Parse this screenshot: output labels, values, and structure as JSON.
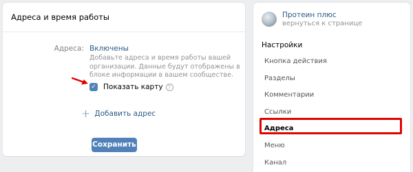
{
  "main": {
    "title": "Адреса и время работы",
    "field_label": "Адреса:",
    "field_value": "Включены",
    "hint": "Добавьте адреса и время работы вашей организации. Данные будут отображены в блоке информации в вашем сообществе.",
    "checkbox_label": "Показать карту",
    "checkbox_checked": true,
    "help_icon": "?",
    "add_address_label": "Добавить адрес",
    "save_label": "Сохранить"
  },
  "side": {
    "community_name": "Протеин плюс",
    "community_back": "вернуться к странице",
    "settings_title": "Настройки",
    "menu": [
      {
        "label": "Кнопка действия"
      },
      {
        "label": "Разделы"
      },
      {
        "label": "Комментарии"
      },
      {
        "label": "Ссылки"
      },
      {
        "label": "Адреса"
      },
      {
        "label": "Меню"
      },
      {
        "label": "Канал"
      }
    ],
    "active_item": "Адреса"
  },
  "colors": {
    "accent": "#5181b8",
    "link": "#2a5885",
    "annotation_red": "#e10000"
  }
}
